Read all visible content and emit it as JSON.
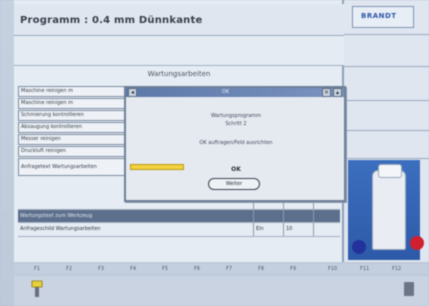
{
  "header": {
    "program_title": "Programm : 0.4 mm Dünnkante",
    "logo_text": "BRANDT"
  },
  "section": {
    "title": "Wartungsarbeiten"
  },
  "menu": {
    "items": [
      "Maschine reinigen m",
      "Maschine reinigen m",
      "Schmierung kontrollieren",
      "Absaugung kontrollieren",
      "Messer reinigen",
      "Druckluft reinigen",
      "Anfragetext Wartungsarbeiten"
    ]
  },
  "dialog": {
    "title": "OK",
    "message_line1": "Wartungsprogramm",
    "message_line2": "Schritt 2",
    "message_line3": "OK auftragen/Feld ausrichten",
    "ok_label": "OK",
    "button_label": "Weiter"
  },
  "table": {
    "header": [
      "Wartungstext zum Werkzeug",
      "",
      ""
    ],
    "rows": [
      [
        "",
        "",
        ""
      ],
      [
        "Anfrageschild Wartungsarbeiten",
        "Ein",
        "10"
      ]
    ]
  },
  "fkeys": [
    "F1",
    "F2",
    "F3",
    "F4",
    "F5",
    "F6",
    "F7",
    "F8",
    "F9",
    "F10",
    "F11",
    "F12"
  ],
  "colors": {
    "dialog_field": "#f4d23e",
    "accent_blue": "#2d5aa8",
    "status_red": "#d02030"
  }
}
